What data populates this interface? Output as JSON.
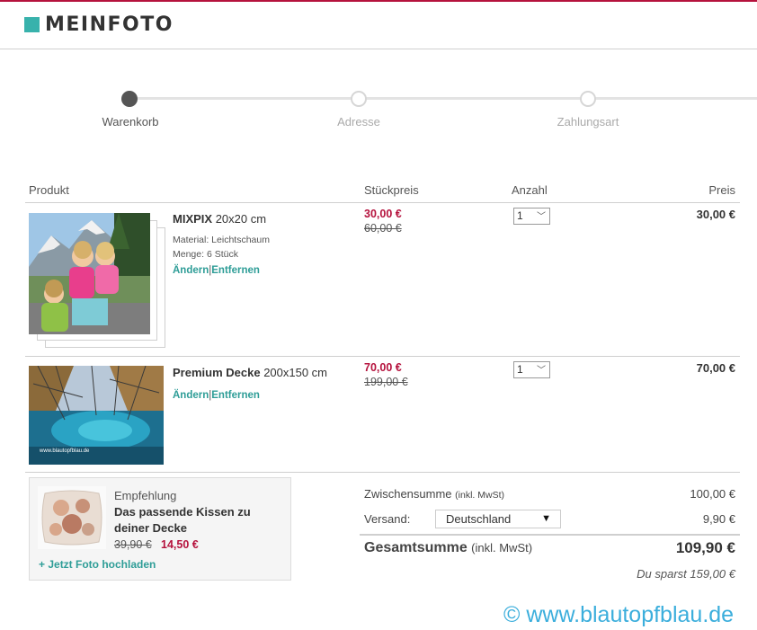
{
  "brand": {
    "name": "MEINFOTO",
    "accent": "#38b2ac",
    "topline": "#b5123d"
  },
  "steps": [
    {
      "label": "Warenkorb",
      "active": true
    },
    {
      "label": "Adresse",
      "active": false
    },
    {
      "label": "Zahlungsart",
      "active": false
    }
  ],
  "table": {
    "headers": {
      "product": "Produkt",
      "unit_price": "Stückpreis",
      "quantity": "Anzahl",
      "price": "Preis"
    }
  },
  "items": [
    {
      "name": "MIXPIX",
      "size": "20x20 cm",
      "material": "Material: Leichtschaum",
      "amount": "Menge: 6 Stück",
      "edit": "Ändern",
      "separator": "|",
      "remove": "Entfernen",
      "price_new": "30,00 €",
      "price_old": "60,00 €",
      "qty": "1",
      "total": "30,00 €",
      "image": "photo-children-mountains"
    },
    {
      "name": "Premium Decke",
      "size": "200x150 cm",
      "edit": "Ändern",
      "separator": "|",
      "remove": "Entfernen",
      "price_new": "70,00 €",
      "price_old": "199,00 €",
      "qty": "1",
      "total": "70,00 €",
      "image": "photo-blue-spring-trees",
      "image_caption": "www.blautopfblau.de"
    }
  ],
  "recommendation": {
    "title": "Empfehlung",
    "name": "Das passende Kissen zu deiner Decke",
    "price_old": "39,90 €",
    "price_new": "14,50 €",
    "upload": "+ Jetzt Foto hochladen",
    "image": "photo-cushion"
  },
  "summary": {
    "subtotal_label": "Zwischensumme",
    "subtotal_note": "(inkl. MwSt)",
    "subtotal": "100,00 €",
    "shipping_label": "Versand:",
    "shipping_country": "Deutschland",
    "shipping": "9,90 €",
    "grand_label": "Gesamtsumme",
    "grand_note": "(inkl. MwSt)",
    "grand_total": "109,90 €",
    "savings": "Du sparst 159,00 €"
  },
  "watermark": "© www.blautopfblau.de"
}
